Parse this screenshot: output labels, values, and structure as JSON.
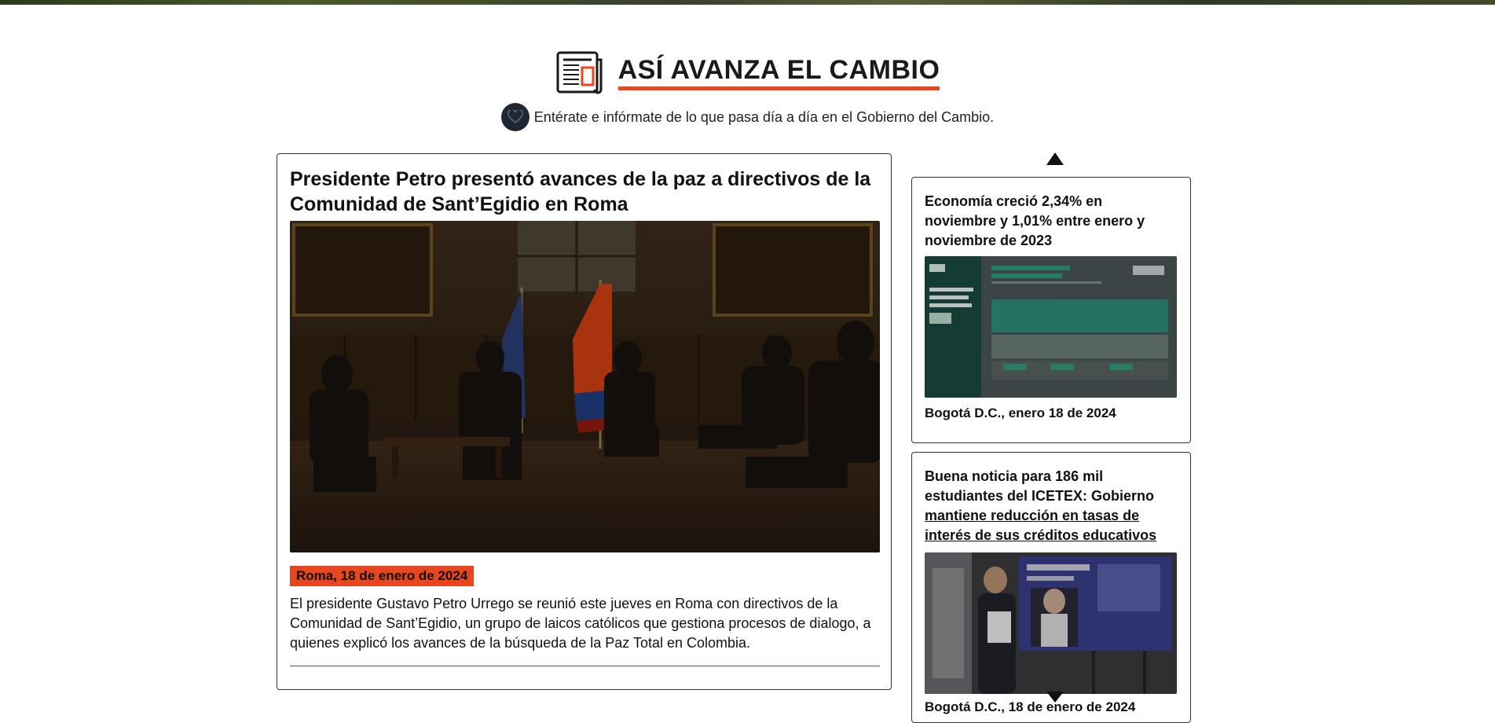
{
  "section": {
    "title": "ASÍ AVANZA EL CAMBIO",
    "subtitle": "Entérate e infórmate de lo que pasa día a día en el Gobierno del Cambio.",
    "accent_color": "#e8461e",
    "icon": "newspaper-icon"
  },
  "featured": {
    "title": "Presidente Petro presentó avances de la paz a directivos de la Comunidad de Sant’Egidio en Roma",
    "date": "Roma, 18 de enero de 2024",
    "excerpt": "El presidente Gustavo Petro Urrego se reunió este jueves en Roma con directivos de la Comunidad de Sant’Egidio, un grupo de laicos católicos que gestiona procesos de dialogo, a quienes explicó los avances de la búsqueda de la Paz Total en Colombia."
  },
  "sidebar": {
    "items": [
      {
        "title": "Economía creció 2,34% en noviembre y 1,01% entre enero y noviembre de 2023",
        "date": "Bogotá D.C., enero 18 de 2024"
      },
      {
        "title_part1": "Buena noticia para 186 mil estudiantes del ICETEX: Gobierno",
        "title_part2": "mantiene reducción en tasas de interés de sus créditos educativos",
        "date": "Bogotá D.C., 18 de enero de 2024"
      }
    ]
  }
}
